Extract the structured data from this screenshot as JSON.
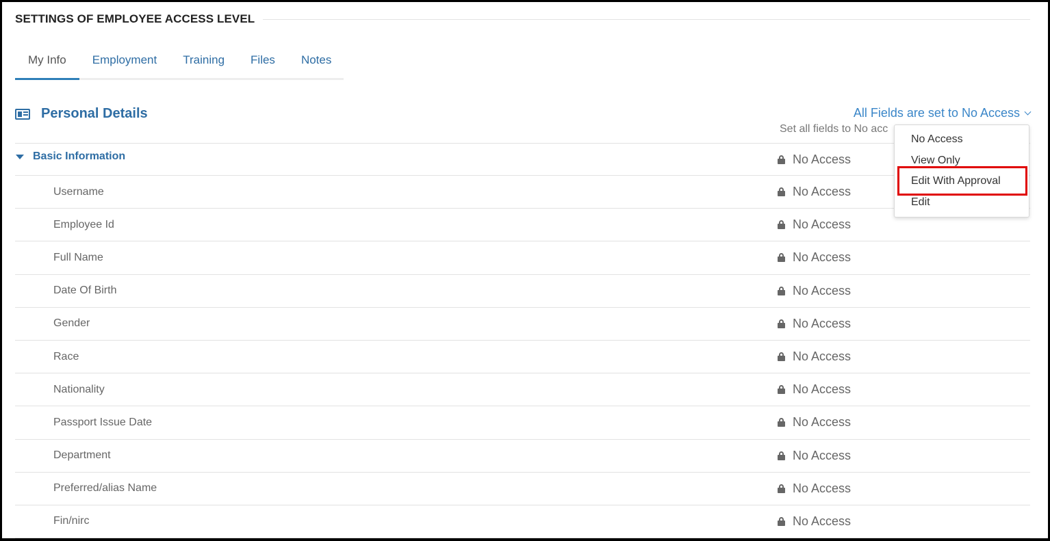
{
  "section": {
    "title": "SETTINGS OF EMPLOYEE ACCESS LEVEL"
  },
  "tabs": [
    {
      "label": "My Info",
      "active": true
    },
    {
      "label": "Employment"
    },
    {
      "label": "Training"
    },
    {
      "label": "Files"
    },
    {
      "label": "Notes"
    }
  ],
  "personal_details": {
    "icon": "id-card-icon",
    "title": "Personal Details",
    "bulk_label": "All Fields are set to No Access",
    "bulk_hint": "Set all fields to No acc"
  },
  "group": {
    "label": "Basic Information",
    "access": "No Access"
  },
  "fields": [
    {
      "label": "Username",
      "access": "No Access"
    },
    {
      "label": "Employee Id",
      "access": "No Access"
    },
    {
      "label": "Full Name",
      "access": "No Access"
    },
    {
      "label": "Date Of Birth",
      "access": "No Access"
    },
    {
      "label": "Gender",
      "access": "No Access"
    },
    {
      "label": "Race",
      "access": "No Access"
    },
    {
      "label": "Nationality",
      "access": "No Access"
    },
    {
      "label": "Passport Issue Date",
      "access": "No Access"
    },
    {
      "label": "Department",
      "access": "No Access"
    },
    {
      "label": "Preferred/alias Name",
      "access": "No Access"
    },
    {
      "label": "Fin/nirc",
      "access": "No Access"
    }
  ],
  "dropdown": {
    "options": [
      "No Access",
      "View Only",
      "Edit With Approval",
      "Edit"
    ],
    "highlighted": "Edit With Approval"
  },
  "colors": {
    "link": "#2e6da4",
    "highlight": "#e00000",
    "tab_indicator": "#2e7fb8"
  }
}
